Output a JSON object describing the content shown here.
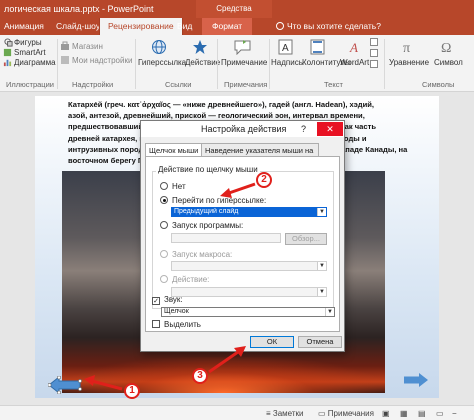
{
  "titlebar": {
    "title": "логическая шкала.pptx - PowerPoint",
    "context_group": "Средства рисования"
  },
  "tabs": [
    "Анимация",
    "Слайд-шоу",
    "Рецензирование",
    "Вид",
    "Формат"
  ],
  "tell_me": "Что вы хотите сделать?",
  "ribbon": {
    "figures": "Фигуры",
    "smartart": "SmartArt",
    "diagram": "Диаграмма",
    "store": "Магазин",
    "my_addins": "Мои надстройки",
    "hyperlink": "Гиперссылка",
    "action": "Действие",
    "comment": "Примечание",
    "textbox": "Надпись",
    "header_footer": "Колонтитулы",
    "wordart": "WordArt",
    "equation": "Уравнение",
    "symbol": "Символ",
    "groups": {
      "illustrations": "Иллюстрации",
      "addins": "Надстройки",
      "links": "Ссылки",
      "comments": "Примечания",
      "text": "Текст",
      "symbols": "Символы"
    }
  },
  "slide": {
    "lines": [
      "Катархе́й (греч. κατ᾽ἀρχαῖος — «ниже древнейшего»), гадей (англ. Hadean), хэдий,",
      "азой, антезой, древнейший, приской — геологический эон, интервал времени,",
      "предшествовавший архею. Катархей на сегодняшний день выделяется как часть",
      "древней катархея, который завершился около 3,8–4 млрд лет назад. Породы и",
      "интрузивных пород катархея немногочисленны, их находят на северо-западе Канады, на",
      "восточном берегу Гренландии"
    ]
  },
  "dialog": {
    "title": "Настройка действия",
    "help": "?",
    "close": "✕",
    "tab_click": "Щелчок мыши",
    "tab_hover": "Наведение указателя мыши на",
    "group_label": "Действие по щелчку мыши",
    "opt_none": "Нет",
    "opt_hyperlink": "Перейти по гиперссылке:",
    "hyperlink_value": "Предыдущий слайд",
    "opt_program": "Запуск программы:",
    "browse": "Обзор...",
    "opt_macro": "Запуск макроса:",
    "opt_action": "Действие:",
    "sound_label": "Звук:",
    "sound_value": "Щелчок",
    "highlight_label": "Выделить",
    "ok": "ОК",
    "cancel": "Отмена"
  },
  "callouts": [
    "1",
    "2",
    "3"
  ],
  "statusbar": {
    "notes": "Заметки",
    "comments": "Примечания"
  },
  "colors": {
    "accent": "#b7472a",
    "callout": "#e0201b",
    "selection": "#0a64d6",
    "slide_arrow": "#4f8fd1"
  }
}
